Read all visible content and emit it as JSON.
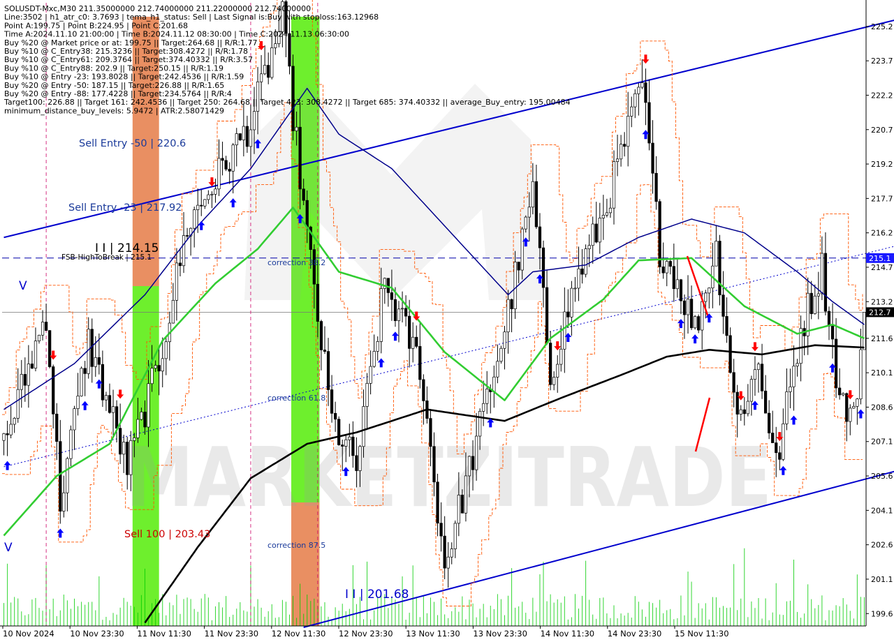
{
  "window": {
    "header_lines": [
      "SOLUSDT-Mxc,M30  211.35000000 212.74000000 211.22000000 212.74000000",
      "Line:3502 | h1_atr_c0: 3.7693 | tema_h1_status: Sell | Last Signal is:Buy with stoploss:163.12968",
      "Point A:199.75 | Point B:224.95 | Point C:201.68",
      "Time A:2024.11.10 21:00:00 | Time B:2024.11.12 08:30:00 | Time C:2024.11.13 06:30:00",
      "Buy %20 @ Market price or at: 199.75 || Target:264.68 || R/R:1.77",
      "Buy %10 @ C_Entry38: 215.3236 || Target:308.4272 || R/R:1.78",
      "Buy %10 @ C_Entry61: 209.3764 || Target:374.40332 || R/R:3.57",
      "Buy %10 @ C_Entry88: 202.9 || Target:250.15 || R/R:1.19",
      "Buy %10 @ Entry -23: 193.8028 || Target:242.4536 || R/R:1.59",
      "Buy %20 @ Entry -50: 187.15 || Target:226.88 || R/R:1.65",
      "Buy %20 @ Entry -88: 177.4228 || Target:234.5764 || R/R:4",
      "Target100: 226.88 || Target 161: 242.4536 || Target 250: 264.68 || Target 423: 308.4272 || Target 685: 374.40332 || average_Buy_entry: 195.00484",
      "minimum_distance_buy_levels: 5.9472 | ATR:2.58071429"
    ]
  },
  "colors": {
    "background": "#ffffff",
    "candle": "#000000",
    "blue_ma": "#00008b",
    "green_ma": "#32cd32",
    "black_ma": "#000000",
    "channel": "#0000cd",
    "orange_band": "#e8895a",
    "green_band": "#66ee22",
    "buy_arrow": "#0000ff",
    "sell_arrow": "#ff0000",
    "volume": "#00cc00",
    "price_label_bg": "#1a1aff",
    "current_price_bg": "#000000"
  },
  "annotations": {
    "sell_entry_50": "Sell Entry -50 | 220.6",
    "sell_entry_23": "Sell Entry -23 | 217.92",
    "point_b": "I I | 214.15",
    "fsb_high": "FSB-HighToBreak | 215.1",
    "correction_38": "correction 38.2",
    "correction_61": "correction 61.8",
    "correction_87": "correction 87.5",
    "sell_100": "Sell 100 | 203.43",
    "point_c": "I I | 201.68",
    "v_top": "V",
    "v_bottom": "V",
    "watermark": "MARKETZITRADE"
  },
  "chart_data": {
    "type": "candlestick",
    "symbol": "SOLUSDT-Mxc",
    "timeframe": "M30",
    "ohlc_last": {
      "open": 211.35,
      "high": 212.74,
      "low": 211.22,
      "close": 212.74
    },
    "y_ticks": [
      225.2,
      223.7,
      222.2,
      220.7,
      219.2,
      217.7,
      216.2,
      214.7,
      213.2,
      211.6,
      210.1,
      208.6,
      207.1,
      205.6,
      204.1,
      202.6,
      201.1,
      199.6
    ],
    "ylim": [
      199.06,
      226.23
    ],
    "x_ticks": [
      "10 Nov 2024",
      "10 Nov 23:30",
      "11 Nov 11:30",
      "11 Nov 23:30",
      "12 Nov 11:30",
      "12 Nov 23:30",
      "13 Nov 11:30",
      "13 Nov 23:30",
      "14 Nov 11:30",
      "14 Nov 23:30",
      "15 Nov 11:30"
    ],
    "bars": 245,
    "price_labels": [
      {
        "value": 215.1,
        "label": "215.1"
      },
      {
        "value": 212.74,
        "label": "212.7"
      }
    ],
    "anchors": [
      [
        0,
        207.0
      ],
      [
        12,
        212.7
      ],
      [
        16,
        204.5
      ],
      [
        24,
        211.5
      ],
      [
        35,
        206.0
      ],
      [
        44,
        210.5
      ],
      [
        52,
        216.5
      ],
      [
        60,
        218.5
      ],
      [
        70,
        221.0
      ],
      [
        79,
        225.5
      ],
      [
        86,
        216.0
      ],
      [
        93,
        208.0
      ],
      [
        100,
        206.0
      ],
      [
        108,
        214.0
      ],
      [
        118,
        210.5
      ],
      [
        125,
        201.68
      ],
      [
        133,
        206.5
      ],
      [
        142,
        212.0
      ],
      [
        150,
        218.0
      ],
      [
        155,
        210.0
      ],
      [
        162,
        214.0
      ],
      [
        170,
        217.0
      ],
      [
        181,
        222.7
      ],
      [
        186,
        215.5
      ],
      [
        190,
        214.5
      ],
      [
        196,
        212.0
      ],
      [
        202,
        215.5
      ],
      [
        208,
        208.0
      ],
      [
        214,
        210.5
      ],
      [
        219,
        206.0
      ],
      [
        226,
        212.0
      ],
      [
        232,
        214.7
      ],
      [
        237,
        209.0
      ],
      [
        241,
        208.0
      ],
      [
        244,
        212.74
      ]
    ],
    "levels": {
      "fsb_high_to_break": 215.1,
      "current_price": 212.74
    },
    "series": [
      {
        "name": "blue_ma",
        "values": [
          [
            0,
            208.5
          ],
          [
            20,
            210.5
          ],
          [
            40,
            213.5
          ],
          [
            55,
            216.5
          ],
          [
            70,
            219.0
          ],
          [
            86,
            222.5
          ],
          [
            95,
            220.5
          ],
          [
            110,
            219.0
          ],
          [
            125,
            216.5
          ],
          [
            143,
            213.5
          ],
          [
            150,
            214.5
          ],
          [
            165,
            214.8
          ],
          [
            180,
            216.0
          ],
          [
            195,
            216.8
          ],
          [
            210,
            216.2
          ],
          [
            225,
            214.5
          ],
          [
            235,
            213.2
          ],
          [
            244,
            212.2
          ]
        ]
      },
      {
        "name": "green_ma",
        "values": [
          [
            0,
            203.0
          ],
          [
            15,
            205.6
          ],
          [
            30,
            207.0
          ],
          [
            45,
            211.5
          ],
          [
            60,
            214.0
          ],
          [
            72,
            215.5
          ],
          [
            82,
            217.3
          ],
          [
            95,
            214.5
          ],
          [
            110,
            213.8
          ],
          [
            125,
            211.0
          ],
          [
            142,
            208.9
          ],
          [
            155,
            211.6
          ],
          [
            170,
            213.3
          ],
          [
            180,
            215.0
          ],
          [
            195,
            215.1
          ],
          [
            210,
            213.0
          ],
          [
            225,
            211.8
          ],
          [
            235,
            212.2
          ],
          [
            244,
            211.6
          ]
        ]
      },
      {
        "name": "black_ma",
        "values": [
          [
            40,
            199.2
          ],
          [
            55,
            202.5
          ],
          [
            70,
            205.5
          ],
          [
            86,
            207.0
          ],
          [
            100,
            207.5
          ],
          [
            120,
            208.5
          ],
          [
            142,
            208.0
          ],
          [
            158,
            209.0
          ],
          [
            175,
            210.0
          ],
          [
            188,
            210.8
          ],
          [
            200,
            211.1
          ],
          [
            215,
            210.9
          ],
          [
            230,
            211.3
          ],
          [
            244,
            211.2
          ]
        ]
      }
    ],
    "channel": {
      "upper": [
        [
          0,
          216.0
        ],
        [
          272,
          226.2
        ]
      ],
      "lower": [
        [
          85,
          199.0
        ],
        [
          297,
          207.6
        ]
      ],
      "mid_dotted": [
        [
          0,
          206.0
        ],
        [
          310,
          217.8
        ]
      ]
    }
  }
}
